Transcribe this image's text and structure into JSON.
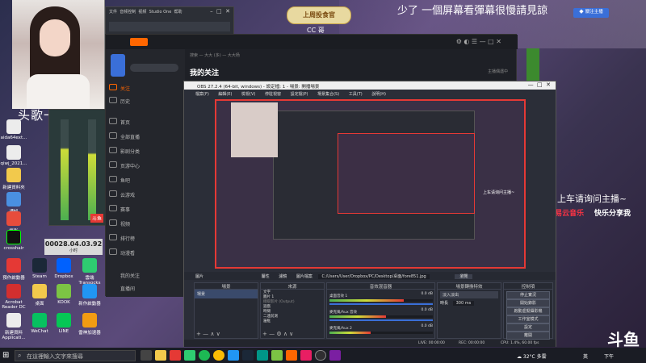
{
  "overlay": {
    "caption_top": "少了 一個屏幕看彈幕很慢請見諒",
    "badge_top": "上周投食官",
    "badge_cc": "CC 哥",
    "top_right_btn": "關注主播",
    "streamer_name": "头歌一天",
    "song_request": "上车请询问主播~",
    "music_brand_1": "网易云音乐",
    "music_brand_2": "快乐分享我",
    "timer": "00028.04.03.92",
    "timer_sub": "小时",
    "bottom_brand": "斗鱼",
    "webcam_label_small": "斗鱼"
  },
  "studio_one": {
    "menu": [
      "文件",
      "音频控制",
      "视频",
      "Studio One",
      "帮助"
    ]
  },
  "desktop_icons": [
    {
      "label": "aida64ext..."
    },
    {
      "label": "qiwj_2021..."
    },
    {
      "label": "新建資料夾"
    },
    {
      "label": "通知"
    },
    {
      "label": "錄影"
    },
    {
      "label": "crosshair"
    },
    {
      "label": "預作啟動器"
    },
    {
      "label": "Steam"
    },
    {
      "label": "Dropbox"
    },
    {
      "label": "雲端 Transocks"
    },
    {
      "label": "Acrobat Reader DC"
    },
    {
      "label": "桌面"
    },
    {
      "label": "KOOK"
    },
    {
      "label": "新作啟動器"
    },
    {
      "label": "新建資料 Applicati..."
    },
    {
      "label": "WeChat"
    },
    {
      "label": "LINE"
    },
    {
      "label": "雷神加速器"
    }
  ],
  "douyu": {
    "title": "我的关注",
    "search_hint": "搜索 — 大大 (多) — 大大杨",
    "sidebar": [
      {
        "label": "关注",
        "active": true
      },
      {
        "label": "历史"
      },
      {
        "label": "首页"
      },
      {
        "label": "全部直播"
      },
      {
        "label": "影剧分类"
      },
      {
        "label": "页游中心"
      },
      {
        "label": "鱼吧"
      },
      {
        "label": "云游戏"
      },
      {
        "label": "赛事"
      },
      {
        "label": "视频"
      },
      {
        "label": "排行榜"
      },
      {
        "label": "动漫看"
      },
      {
        "label": "我的关注"
      },
      {
        "label": "直播间"
      }
    ],
    "right_text": "主播偶遇中"
  },
  "obs": {
    "title": "OBS 27.2.4 (64-bit, windows) - 設定檔: 1 - 場景: 開播場景",
    "menu": [
      "檔案(F)",
      "編輯(E)",
      "檢視(V)",
      "停駐視窗",
      "設定檔(P)",
      "場景集合(S)",
      "工具(T)",
      "說明(H)"
    ],
    "source_bar": [
      "圖片",
      "屬性",
      "濾鏡",
      "圖片檔案",
      "C:/Users/User/Dropbox/PC/Desktop/桌面/fore851.jpg",
      "瀏覽"
    ],
    "docks": {
      "scenes_title": "場景",
      "sources_title": "來源",
      "mixer_title": "音效混音器",
      "transitions_title": "場景轉換特效",
      "controls_title": "控制項"
    },
    "scenes": [
      "場景"
    ],
    "sources": [
      "文字",
      "圖片 1",
      "擷取影片 (Output)",
      "遊戲",
      "時間",
      "二連前測",
      "邊框"
    ],
    "mixer": [
      {
        "label": "桌面音效 1",
        "level": "0.0 dB",
        "fill": 0.72
      },
      {
        "label": "麥克風/Aux 音效",
        "level": "0.0 dB",
        "fill": 0.55
      },
      {
        "label": "麥克風/Aux 2",
        "level": "0.0 dB",
        "fill": 0.4
      }
    ],
    "transition": {
      "type": "淡入淡出",
      "duration_label": "時長",
      "duration": "300 ms"
    },
    "controls": [
      "停止實況",
      "開始錄影",
      "啟動虛擬攝影機",
      "工作室模式",
      "設定",
      "離開"
    ],
    "status": {
      "live": "LIVE: 00:00:00",
      "rec": "REC: 00:00:00",
      "cpu": "CPU: 1.4%, 60.00 fps"
    }
  },
  "taskbar": {
    "search_placeholder": "在這裡輸入文字來搜尋",
    "temp": "32°C",
    "weather": "多雲",
    "time": "下午",
    "lang": "英"
  },
  "colors": {
    "accent_red": "#ff3344",
    "douyu_orange": "#ff6600",
    "obs_bg": "#2b2e38"
  }
}
